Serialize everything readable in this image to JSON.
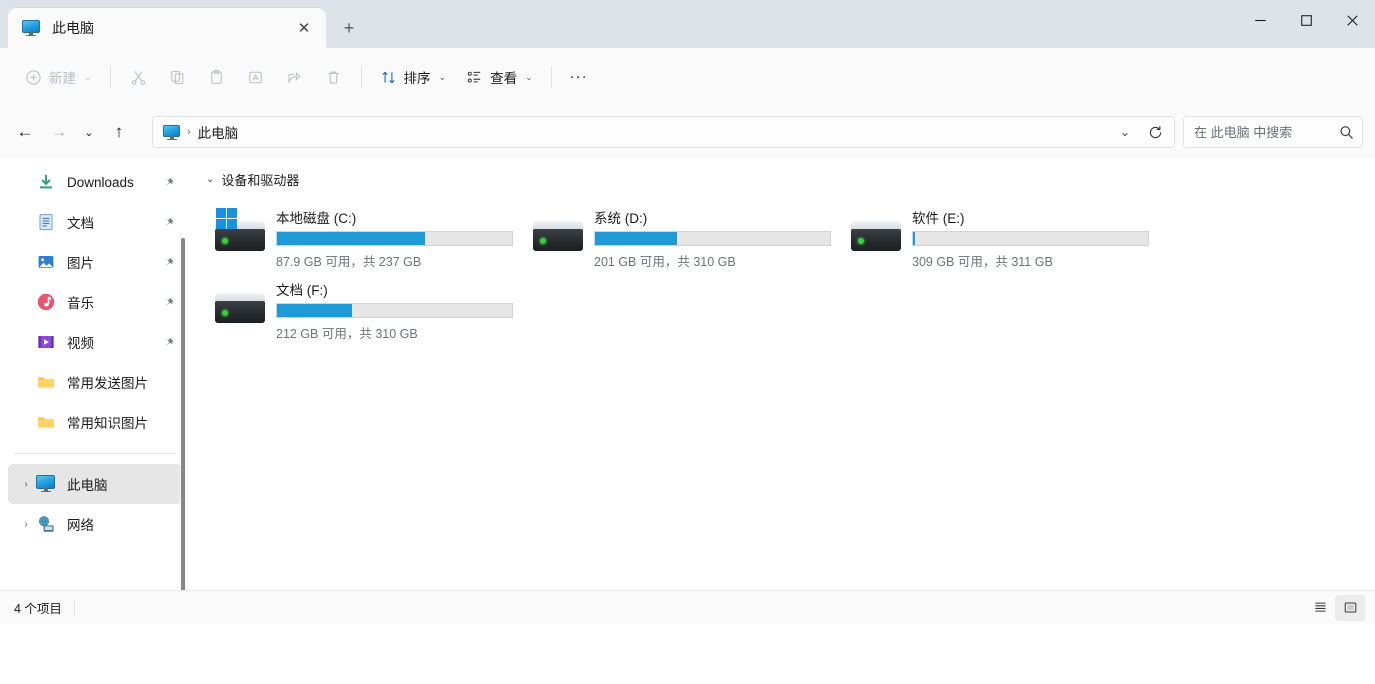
{
  "window": {
    "tab": {
      "title": "此电脑",
      "icon": "monitor-icon",
      "close_label": "✕"
    },
    "new_tab_label": "+",
    "controls": {
      "minimize": "—",
      "maximize": "☐",
      "close": "✕"
    }
  },
  "toolbar": {
    "new_label": "新建",
    "cut_label": "剪切",
    "copy_label": "复制",
    "paste_label": "粘贴",
    "rename_label": "重命名",
    "share_label": "共享",
    "delete_label": "删除",
    "sort_label": "排序",
    "view_label": "查看",
    "more_label": "···",
    "chevron": "⌄"
  },
  "navbar": {
    "back_label": "←",
    "forward_label": "→",
    "recent_label": "⌄",
    "up_label": "↑",
    "breadcrumb": {
      "icon": "monitor-icon",
      "separator": "›",
      "text": "此电脑"
    },
    "address_dropdown": "⌄",
    "refresh_label": "⟳"
  },
  "search": {
    "placeholder": "在 此电脑 中搜索",
    "icon": "search-icon",
    "value": ""
  },
  "sidebar": {
    "items": [
      {
        "label": "Downloads",
        "icon": "downloads-icon",
        "pinned": true
      },
      {
        "label": "文档",
        "icon": "documents-icon",
        "pinned": true
      },
      {
        "label": "图片",
        "icon": "pictures-icon",
        "pinned": true
      },
      {
        "label": "音乐",
        "icon": "music-icon",
        "pinned": true
      },
      {
        "label": "视频",
        "icon": "videos-icon",
        "pinned": true
      },
      {
        "label": "常用发送图片",
        "icon": "folder-icon",
        "pinned": false
      },
      {
        "label": "常用知识图片",
        "icon": "folder-icon",
        "pinned": false
      }
    ],
    "tree": [
      {
        "label": "此电脑",
        "icon": "monitor-icon",
        "expander": "›",
        "selected": true
      },
      {
        "label": "网络",
        "icon": "network-icon",
        "expander": "›",
        "selected": false
      }
    ],
    "pin_glyph": "📌"
  },
  "content": {
    "group_title": "设备和驱动器",
    "group_chevron": "⌄",
    "drives": [
      {
        "name": "本地磁盘 (C:)",
        "detail": "87.9 GB 可用，共 237 GB",
        "free_gb": 87.9,
        "total_gb": 237,
        "used_percent": 63,
        "system": true
      },
      {
        "name": "系统 (D:)",
        "detail": "201 GB 可用，共 310 GB",
        "free_gb": 201,
        "total_gb": 310,
        "used_percent": 35,
        "system": false
      },
      {
        "name": "软件 (E:)",
        "detail": "309 GB 可用，共 311 GB",
        "free_gb": 309,
        "total_gb": 311,
        "used_percent": 1,
        "system": false
      },
      {
        "name": "文档 (F:)",
        "detail": "212 GB 可用，共 310 GB",
        "free_gb": 212,
        "total_gb": 310,
        "used_percent": 32,
        "system": false
      }
    ]
  },
  "statusbar": {
    "item_count": "4 个项目",
    "details_view_label": "详细信息视图",
    "icons_view_label": "大图标视图"
  },
  "colors": {
    "accent": "#1f9ad6",
    "titlebar_bg": "#dde3e8",
    "chrome_bg": "#fafafa",
    "selection_bg": "#e6e6e6",
    "bar_track": "#e6e6e6"
  }
}
